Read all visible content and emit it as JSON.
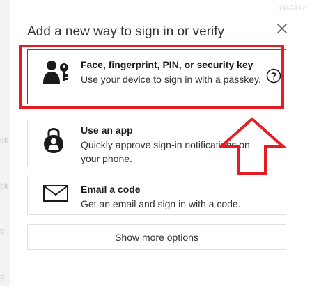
{
  "dialog": {
    "title": "Add a new way to sign in or verify",
    "close_icon": "close-icon"
  },
  "options": {
    "passkey": {
      "icon": "passkey-person-key-icon",
      "title": "Face, fingerprint, PIN, or security key",
      "description": "Use your device to sign in with a passkey.",
      "help_icon": "question-circle-icon"
    },
    "app": {
      "icon": "authenticator-lock-person-icon",
      "title": "Use an app",
      "description": "Quickly approve sign-in notifications on your phone."
    },
    "email": {
      "icon": "envelope-icon",
      "title": "Email a code",
      "description": "Get an email and sign in with a code."
    },
    "more": {
      "label": "Show more options"
    }
  },
  "background": {
    "ghost_texts": [
      "Q47412",
      "ek",
      "ek",
      "g",
      "g"
    ]
  },
  "annotations": {
    "highlight_color": "#e41c23",
    "arrow_color": "#e41c23"
  }
}
